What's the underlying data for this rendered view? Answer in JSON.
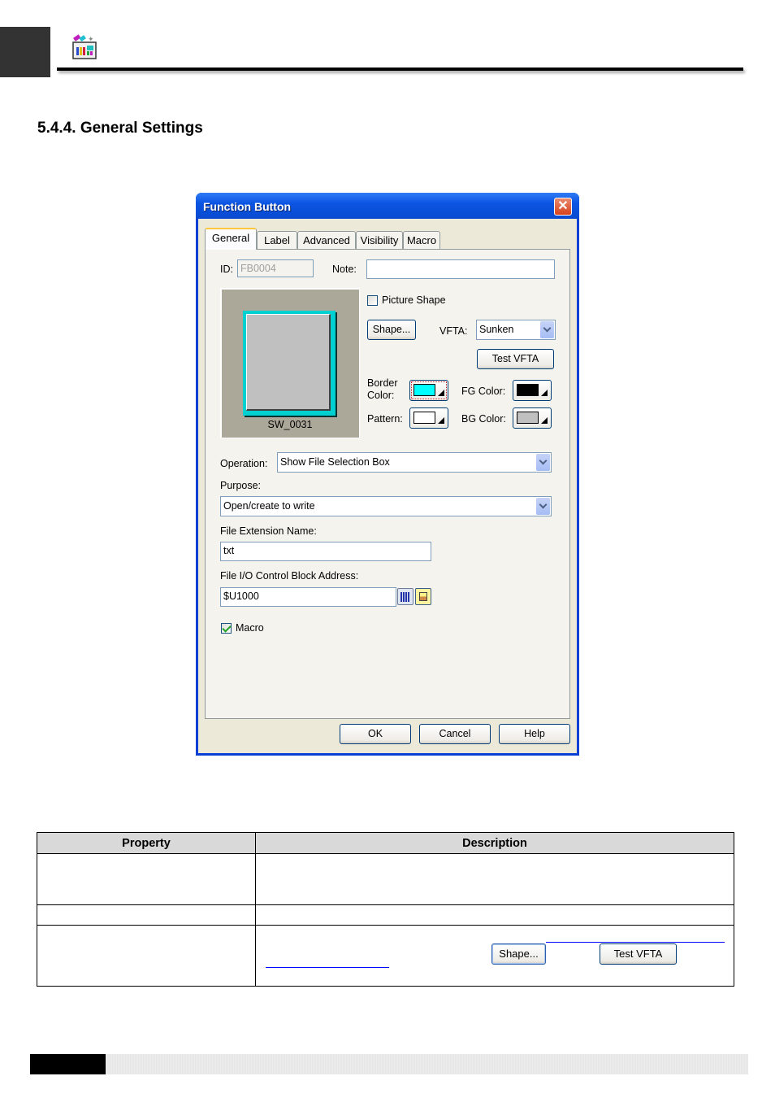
{
  "section": {
    "title": "5.4.4. General Settings"
  },
  "dialog": {
    "title": "Function Button",
    "close_glyph": "✕",
    "tabs": [
      {
        "label": "General",
        "active": true
      },
      {
        "label": "Label",
        "active": false
      },
      {
        "label": "Advanced",
        "active": false
      },
      {
        "label": "Visibility",
        "active": false
      },
      {
        "label": "Macro",
        "active": false
      }
    ],
    "general": {
      "id_label": "ID:",
      "id_value": "FB0004",
      "note_label": "Note:",
      "note_value": "",
      "preview_shape_name": "SW_0031",
      "picture_shape_label": "Picture Shape",
      "picture_shape_checked": false,
      "shape_button": "Shape...",
      "vfta_label": "VFTA:",
      "vfta_value": "Sunken",
      "test_vfta_button": "Test VFTA",
      "border_color_label": "Border Color:",
      "border_color": "#00ffff",
      "fg_color_label": "FG Color:",
      "fg_color": "#000000",
      "pattern_label": "Pattern:",
      "pattern_color": "#ffffff",
      "bg_color_label": "BG Color:",
      "bg_color": "#c0c0c0",
      "operation_label": "Operation:",
      "operation_value": "Show File Selection Box",
      "purpose_label": "Purpose:",
      "purpose_value": "Open/create to write",
      "file_ext_label": "File Extension Name:",
      "file_ext_value": "txt",
      "file_io_label": "File I/O Control Block Address:",
      "file_io_value": "$U1000",
      "macro_label": "Macro",
      "macro_checked": true
    },
    "buttons": {
      "ok": "OK",
      "cancel": "Cancel",
      "help": "Help"
    }
  },
  "table": {
    "headers": [
      "Property",
      "Description"
    ],
    "rows": [
      {
        "property": "",
        "description": ""
      },
      {
        "property": "",
        "description": ""
      },
      {
        "property": "",
        "description": "",
        "inline_buttons": [
          "Shape...",
          "Test VFTA"
        ]
      }
    ]
  },
  "colors": {
    "titlebar": "#0b55e3",
    "dialog_bg": "#ece9d8",
    "table_header_bg": "#d9d9d9",
    "link": "#0000ff"
  }
}
